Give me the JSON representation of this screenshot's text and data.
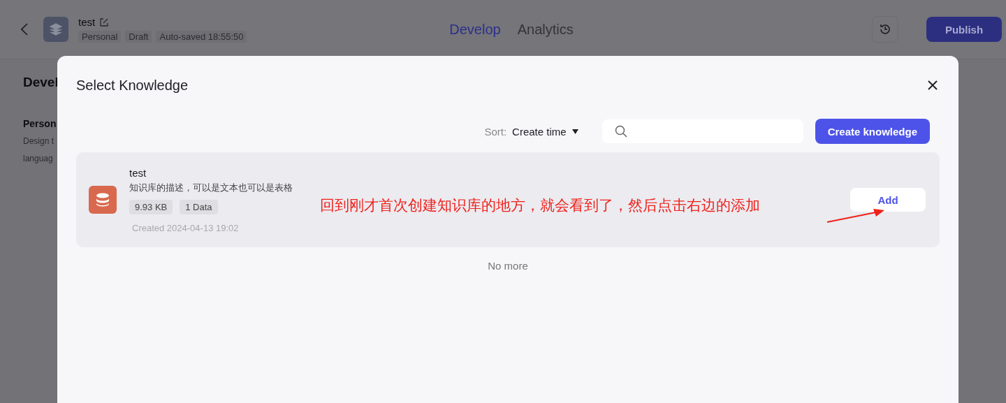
{
  "header": {
    "title": "test",
    "meta": [
      "Personal",
      "Draft",
      "Auto-saved 18:55:50"
    ],
    "tabs": [
      {
        "label": "Develop",
        "selected": true
      },
      {
        "label": "Analytics",
        "selected": false
      }
    ],
    "publish": "Publish"
  },
  "background": {
    "heading": "Devel",
    "section": "Person",
    "lines": [
      "Design t",
      "languag"
    ]
  },
  "modal": {
    "title": "Select Knowledge",
    "sort_label": "Sort:",
    "sort_value": "Create time",
    "create_button": "Create knowledge",
    "items": [
      {
        "name": "test",
        "description": "知识库的描述，可以是文本也可以是表格",
        "tags": [
          "9.93 KB",
          "1 Data"
        ],
        "created": "Created 2024-04-13 19:02",
        "action": "Add"
      }
    ],
    "footer": "No more"
  },
  "annotation": {
    "text": "回到刚才首次创建知识库的地方，就会看到了，然后点击右边的添加"
  }
}
